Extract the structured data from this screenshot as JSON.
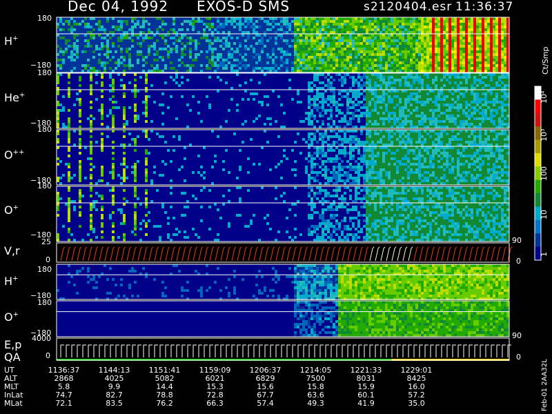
{
  "header": {
    "date": "Dec 04, 1992",
    "instrument": "EXOS-D SMS",
    "file": "s2120404.esr",
    "clock": "11:36:37"
  },
  "panels": [
    {
      "label": "H",
      "sup": "+",
      "top_tick": "180",
      "bottom_tick": "−180"
    },
    {
      "label": "He",
      "sup": "+",
      "top_tick": "180",
      "bottom_tick": "−180"
    },
    {
      "label": "O",
      "sup": "++",
      "top_tick": "180",
      "bottom_tick": "−180"
    },
    {
      "label": "O",
      "sup": "+",
      "top_tick": "180",
      "bottom_tick": "−180"
    },
    {
      "label": "V,r",
      "sup": "",
      "top_tick": "25",
      "bottom_tick": "0",
      "right_top": "90",
      "right_bottom": "0"
    },
    {
      "label": "H",
      "sup": "+",
      "top_tick": "180",
      "bottom_tick": "−180"
    },
    {
      "label": "O",
      "sup": "+",
      "top_tick": "180",
      "bottom_tick": "−180",
      "right_bottom": "90"
    },
    {
      "label": "E,p",
      "sup": "",
      "label2": "QA",
      "top_tick": "4000",
      "bottom_tick": "0",
      "right_bottom": "0"
    }
  ],
  "colorbar": {
    "unit": "Ct/Smp",
    "ticks": [
      "10⁴",
      "10³",
      "100",
      "10",
      "1"
    ],
    "colors": [
      "#ffffff",
      "#ff0000",
      "#cc1111",
      "#886600",
      "#aa9900",
      "#dddd00",
      "#88cc00",
      "#22aa00",
      "#118833",
      "#00aacc",
      "#0077cc",
      "#003399",
      "#000088"
    ]
  },
  "footer": {
    "rows": [
      {
        "label": "UT",
        "values": [
          "1136:37",
          "1144:13",
          "1151:41",
          "1159:09",
          "1206:37",
          "1214:05",
          "1221:33",
          "1229:01"
        ]
      },
      {
        "label": "ALT",
        "values": [
          "2868",
          "4025",
          "5082",
          "6021",
          "6829",
          "7500",
          "8031",
          "8425"
        ]
      },
      {
        "label": "MLT",
        "values": [
          "5.8",
          "9.9",
          "14.4",
          "15.3",
          "15.6",
          "15.8",
          "15.9",
          "16.0"
        ]
      },
      {
        "label": "InLat",
        "values": [
          "74.7",
          "82.7",
          "78.8",
          "72.8",
          "67.7",
          "63.6",
          "60.1",
          "57.2"
        ]
      },
      {
        "label": "MLat",
        "values": [
          "72.1",
          "83.5",
          "76.2",
          "66.3",
          "57.4",
          "49.3",
          "41.9",
          "35.0"
        ]
      }
    ],
    "side_note": "Feb-01 2AA32L"
  },
  "chart_data": {
    "type": "heatmap",
    "title": "Dec 04, 1992   EXOS-D SMS",
    "time_axis_UT": [
      "1136:37",
      "1144:13",
      "1151:41",
      "1159:09",
      "1206:37",
      "1214:05",
      "1221:33",
      "1229:01"
    ],
    "colorbar_unit": "Ct/Smp",
    "colorbar_range": [
      1,
      10000
    ],
    "colorbar_scale": "log",
    "series": [
      {
        "name": "H+",
        "ylim": [
          -180,
          180
        ]
      },
      {
        "name": "He+",
        "ylim": [
          -180,
          180
        ]
      },
      {
        "name": "O++",
        "ylim": [
          -180,
          180
        ]
      },
      {
        "name": "O+",
        "ylim": [
          -180,
          180
        ]
      },
      {
        "name": "V,r",
        "ylim": [
          0,
          25
        ],
        "y2lim": [
          0,
          90
        ]
      },
      {
        "name": "H+",
        "ylim": [
          -180,
          180
        ]
      },
      {
        "name": "O+",
        "ylim": [
          -180,
          180
        ]
      },
      {
        "name": "E,p QA",
        "ylim": [
          0,
          4000
        ]
      }
    ]
  }
}
